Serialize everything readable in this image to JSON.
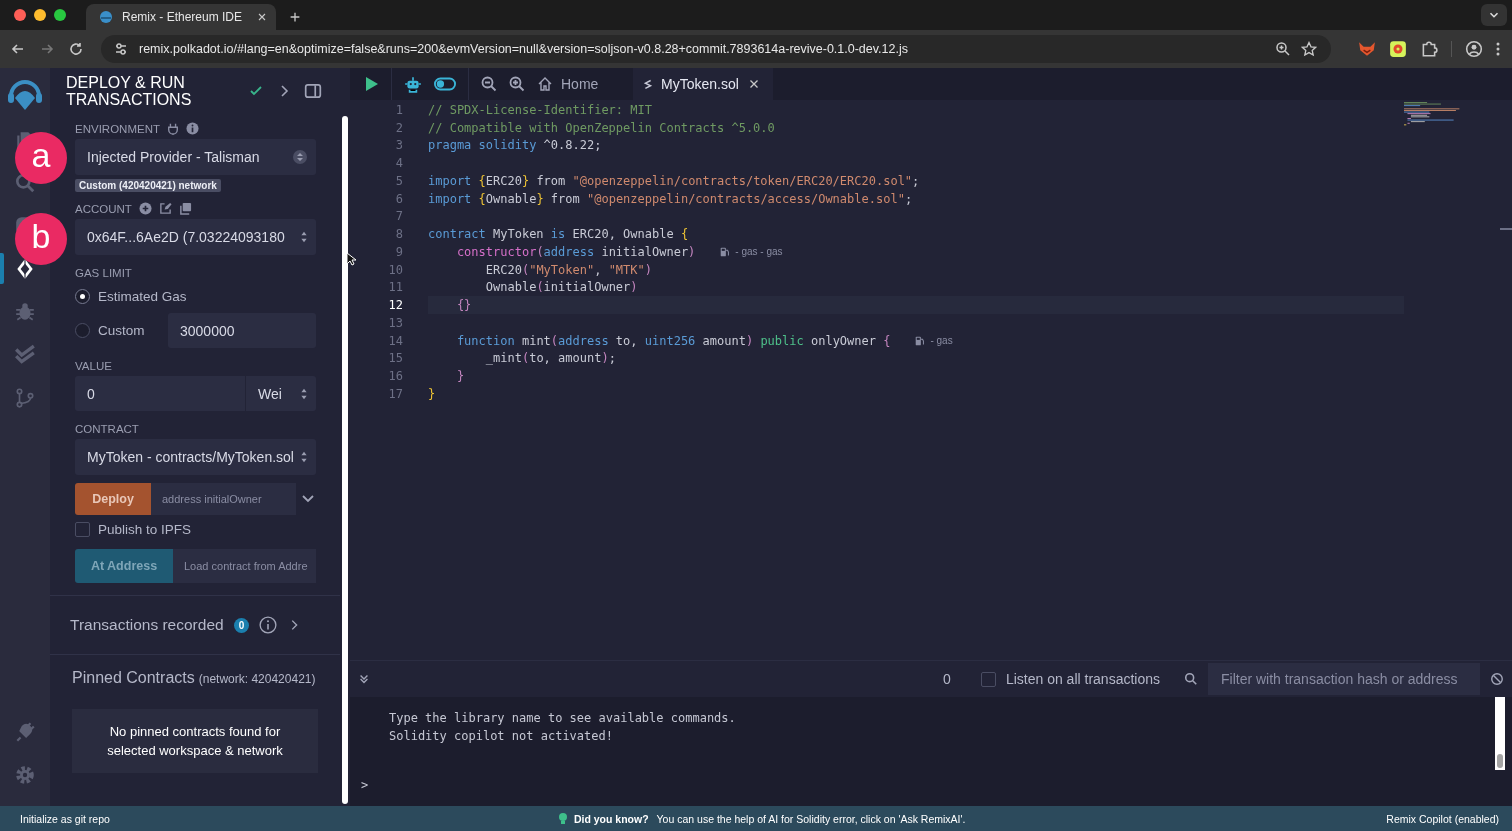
{
  "browser": {
    "tab_title": "Remix - Ethereum IDE",
    "url": "remix.polkadot.io/#lang=en&optimize=false&runs=200&evmVersion=null&version=soljson-v0.8.28+commit.7893614a-revive-0.1.0-dev.12.js"
  },
  "icon_bar": [
    {
      "kind": "files",
      "selected": false
    },
    {
      "kind": "search",
      "selected": false
    },
    {
      "kind": "compiler",
      "selected": false
    },
    {
      "kind": "deploy",
      "selected": true
    },
    {
      "kind": "debugger",
      "selected": false
    },
    {
      "kind": "tests",
      "selected": false
    },
    {
      "kind": "git",
      "selected": false
    }
  ],
  "icon_bar_bottom": [
    {
      "kind": "plugins",
      "selected": false
    },
    {
      "kind": "settings",
      "selected": false
    }
  ],
  "side_panel": {
    "title": "DEPLOY & RUN TRANSACTIONS",
    "environment": {
      "label": "ENVIRONMENT",
      "value": "Injected Provider - Talisman",
      "network": "Custom (420420421) network"
    },
    "account": {
      "label": "ACCOUNT",
      "value": "0x64F...6Ae2D (7.03224093180"
    },
    "gas_limit": {
      "label": "GAS LIMIT",
      "options": [
        {
          "label": "Estimated Gas",
          "selected": true
        },
        {
          "label": "Custom",
          "selected": false,
          "value": "3000000"
        }
      ]
    },
    "value": {
      "label": "VALUE",
      "amount": "0",
      "unit": "Wei"
    },
    "contract": {
      "label": "CONTRACT",
      "value": "MyToken - contracts/MyToken.sol"
    },
    "deploy": {
      "button": "Deploy",
      "placeholder": "address initialOwner"
    },
    "publish": {
      "label": "Publish to IPFS",
      "checked": false
    },
    "at_address": {
      "button": "At Address",
      "placeholder": "Load contract from Addre"
    },
    "transactions": {
      "label": "Transactions recorded",
      "count": "0"
    },
    "pinned": {
      "title": "Pinned Contracts",
      "network": "(network: 420420421)",
      "empty_text": "No pinned contracts found for selected workspace & network"
    }
  },
  "annotations": [
    {
      "label": "a"
    },
    {
      "label": "b"
    }
  ],
  "editor": {
    "tabs": [
      {
        "label": "Home",
        "kind": "home",
        "selected": false
      },
      {
        "label": "MyToken.sol",
        "kind": "file",
        "selected": true
      }
    ],
    "lines": [
      {
        "number": "1",
        "selected": false,
        "tokens": [
          {
            "text": "// SPDX-License-Identifier: MIT",
            "kind": "comment"
          }
        ]
      },
      {
        "number": "2",
        "selected": false,
        "tokens": [
          {
            "text": "// Compatible with OpenZeppelin Contracts ^5.0.0",
            "kind": "comment"
          }
        ]
      },
      {
        "number": "3",
        "selected": false,
        "tokens": [
          {
            "text": "pragma solidity",
            "kind": "kw"
          },
          {
            "text": " ^0.8.22;",
            "kind": "plain"
          }
        ]
      },
      {
        "number": "4",
        "selected": false
      },
      {
        "number": "5",
        "selected": false,
        "tokens": [
          {
            "text": "import",
            "kind": "kw"
          },
          {
            "text": " {",
            "kind": "brace"
          },
          {
            "text": "ERC20",
            "kind": "plain"
          },
          {
            "text": "}",
            "kind": "brace"
          },
          {
            "text": " from ",
            "kind": "plain"
          },
          {
            "text": "\"@openzeppelin/contracts/token/ERC20/ERC20.sol\"",
            "kind": "str"
          },
          {
            "text": ";",
            "kind": "plain"
          }
        ]
      },
      {
        "number": "6",
        "selected": false,
        "tokens": [
          {
            "text": "import",
            "kind": "kw"
          },
          {
            "text": " {",
            "kind": "brace"
          },
          {
            "text": "Ownable",
            "kind": "plain"
          },
          {
            "text": "}",
            "kind": "brace"
          },
          {
            "text": " from ",
            "kind": "plain"
          },
          {
            "text": "\"@openzeppelin/contracts/access/Ownable.sol\"",
            "kind": "str"
          },
          {
            "text": ";",
            "kind": "plain"
          }
        ]
      },
      {
        "number": "7",
        "selected": false
      },
      {
        "number": "8",
        "selected": false,
        "tokens": [
          {
            "text": "contract",
            "kind": "kw"
          },
          {
            "text": " MyToken ",
            "kind": "plain"
          },
          {
            "text": "is",
            "kind": "kw"
          },
          {
            "text": " ERC20, Ownable ",
            "kind": "plain"
          },
          {
            "text": "{",
            "kind": "brace"
          }
        ]
      },
      {
        "number": "9",
        "selected": false,
        "tokens": [
          {
            "text": "    constructor",
            "kind": "fn"
          },
          {
            "text": "(",
            "kind": "paren"
          },
          {
            "text": "address",
            "kind": "kw"
          },
          {
            "text": " initialOwner",
            "kind": "plain"
          },
          {
            "text": ")",
            "kind": "paren"
          }
        ],
        "gas": "- gas - gas"
      },
      {
        "number": "10",
        "selected": false,
        "tokens": [
          {
            "text": "        ERC20",
            "kind": "plain"
          },
          {
            "text": "(",
            "kind": "paren"
          },
          {
            "text": "\"MyToken\"",
            "kind": "str"
          },
          {
            "text": ", ",
            "kind": "plain"
          },
          {
            "text": "\"MTK\"",
            "kind": "str"
          },
          {
            "text": ")",
            "kind": "paren"
          }
        ]
      },
      {
        "number": "11",
        "selected": false,
        "tokens": [
          {
            "text": "        Ownable",
            "kind": "plain"
          },
          {
            "text": "(",
            "kind": "paren"
          },
          {
            "text": "initialOwner",
            "kind": "plain"
          },
          {
            "text": ")",
            "kind": "paren"
          }
        ]
      },
      {
        "number": "12",
        "selected": true,
        "tokens": [
          {
            "text": "    {}",
            "kind": "paren"
          }
        ]
      },
      {
        "number": "13",
        "selected": false
      },
      {
        "number": "14",
        "selected": false,
        "tokens": [
          {
            "text": "    function",
            "kind": "kw"
          },
          {
            "text": " mint",
            "kind": "plain"
          },
          {
            "text": "(",
            "kind": "paren"
          },
          {
            "text": "address",
            "kind": "kw"
          },
          {
            "text": " to, ",
            "kind": "plain"
          },
          {
            "text": "uint256",
            "kind": "kw"
          },
          {
            "text": " amount",
            "kind": "plain"
          },
          {
            "text": ")",
            "kind": "paren"
          },
          {
            "text": " public",
            "kind": "mod"
          },
          {
            "text": " onlyOwner ",
            "kind": "plain"
          },
          {
            "text": "{",
            "kind": "paren"
          }
        ],
        "gas": "- gas"
      },
      {
        "number": "15",
        "selected": false,
        "tokens": [
          {
            "text": "        _mint",
            "kind": "plain"
          },
          {
            "text": "(",
            "kind": "paren"
          },
          {
            "text": "to, amount",
            "kind": "plain"
          },
          {
            "text": ")",
            "kind": "paren"
          },
          {
            "text": ";",
            "kind": "plain"
          }
        ]
      },
      {
        "number": "16",
        "selected": false,
        "tokens": [
          {
            "text": "    }",
            "kind": "paren"
          }
        ]
      },
      {
        "number": "17",
        "selected": false,
        "tokens": [
          {
            "text": "}",
            "kind": "brace"
          }
        ]
      }
    ]
  },
  "terminal": {
    "count": "0",
    "listen": {
      "label": "Listen on all transactions",
      "checked": false
    },
    "filter_placeholder": "Filter with transaction hash or address",
    "output": [
      "Type the library name to see available commands.",
      "Solidity copilot not activated!"
    ],
    "prompt": ">"
  },
  "status_bar": {
    "left": "Initialize as git repo",
    "tip_title": "Did you know?",
    "tip": "You can use the help of AI for Solidity error, click on 'Ask RemixAI'.",
    "right": "Remix Copilot (enabled)"
  }
}
